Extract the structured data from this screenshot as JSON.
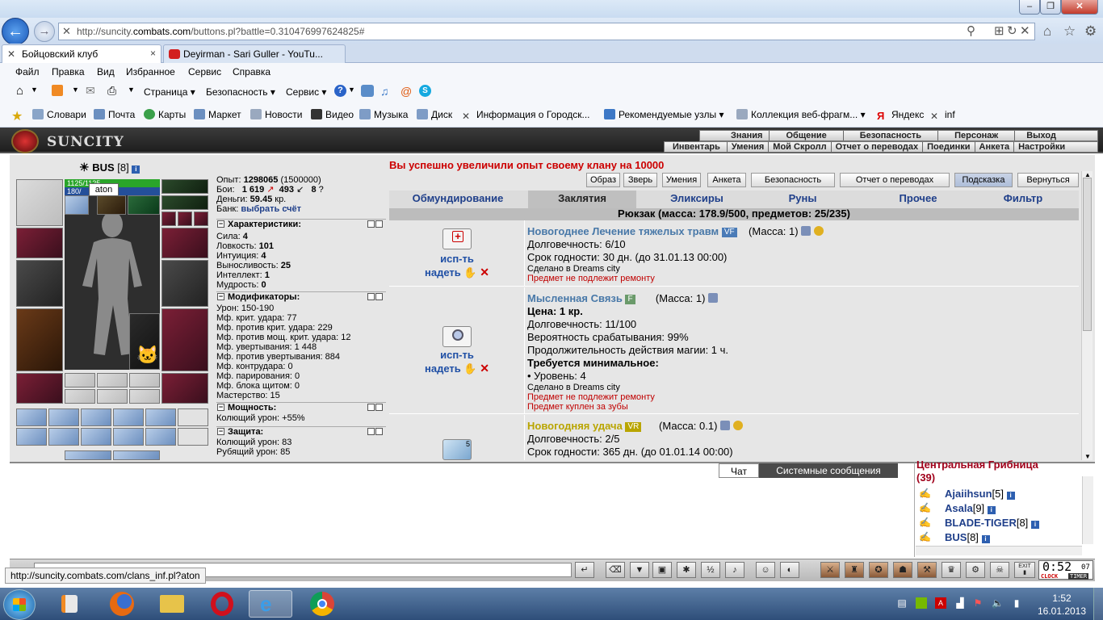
{
  "browser": {
    "url_prefix": "http://suncity.",
    "url_domain": "combats.com",
    "url_rest": "/buttons.pl?battle=0.310476997624825#",
    "tabs": [
      {
        "label": "Бойцовский клуб",
        "close": "×"
      },
      {
        "label": "Deyirman - Sari Guller - YouTu..."
      }
    ],
    "menu": [
      "Файл",
      "Правка",
      "Вид",
      "Избранное",
      "Сервис",
      "Справка"
    ],
    "command": [
      "Страница",
      "Безопасность",
      "Сервис"
    ],
    "favorites": [
      "Словари",
      "Почта",
      "Карты",
      "Маркет",
      "Новости",
      "Видео",
      "Музыка",
      "Диск",
      "Информация о Городск...",
      "Рекомендуемые узлы",
      "Коллекция веб-фрагм...",
      "Яндекс",
      "inf"
    ],
    "status_url": "http://suncity.combats.com/clans_inf.pl?aton"
  },
  "game": {
    "logo": "SUNCITY",
    "nav_top": [
      "Знания",
      "Общение",
      "Безопасность",
      "Персонаж",
      "Выход"
    ],
    "nav_bottom": [
      "Инвентарь",
      "Умения",
      "Мой Скролл",
      "Отчет о переводах",
      "Поединки",
      "Анкета",
      "Настройки"
    ]
  },
  "character": {
    "name": "BUS",
    "level": "[8]",
    "hp": "1125/1125",
    "mp": "180/",
    "tooltip": "aton",
    "exp_label": "Опыт:",
    "exp": "1298065",
    "exp_next": "(1500000)",
    "fights_label": "Бои:",
    "wins": "1 619",
    "losses": "493",
    "draws": "8",
    "money_label": "Деньги:",
    "money": "59.45",
    "money_unit": "кр.",
    "bank_label": "Банк:",
    "bank_link": "выбрать счёт"
  },
  "stats": {
    "characteristics_title": "Характеристики:",
    "characteristics": [
      {
        "label": "Сила:",
        "value": "4"
      },
      {
        "label": "Ловкость:",
        "value": "101"
      },
      {
        "label": "Интуиция:",
        "value": "4"
      },
      {
        "label": "Выносливость:",
        "value": "25"
      },
      {
        "label": "Интеллект:",
        "value": "1"
      },
      {
        "label": "Мудрость:",
        "value": "0"
      }
    ],
    "modifiers_title": "Модификаторы:",
    "modifiers": [
      "Урон: 150-190",
      "Мф. крит. удара: 77",
      "Мф. против крит. удара: 229",
      "Мф. против мощ. крит. удара: 12",
      "Мф. увертывания: 1 448",
      "Мф. против увертывания: 884",
      "Мф. контрудара: 0",
      "Мф. парирования: 0",
      "Мф. блока щитом: 0",
      "Мастерство: 15"
    ],
    "power_title": "Мощность:",
    "power": [
      "Колющий урон: +55%"
    ],
    "defense_title": "Защита:",
    "defense": [
      "Колющий урон: 83",
      "Рубящий урон: 85"
    ]
  },
  "inventory": {
    "message": "Вы успешно увеличили опыт своему клану на 10000",
    "buttons": [
      "Образ",
      "Зверь",
      "Умения",
      "Анкета",
      "Безопасность",
      "Отчет о переводах",
      "Подсказка",
      "Вернуться"
    ],
    "tabs": [
      "Обмундирование",
      "Заклятия",
      "Эликсиры",
      "Руны",
      "Прочее",
      "Фильтр"
    ],
    "backpack": "Рюкзак (масса: 178.9/500, предметов: 25/235)",
    "use_line1": "исп-ть",
    "use_line2": "надеть",
    "delete": "✕",
    "items": [
      {
        "title": "Новогоднее Лечение тяжелых травм",
        "tag": "VF",
        "mass": "(Масса: 1)",
        "lines": [
          "Долговечность: 6/10",
          "Срок годности: 30 дн. (до 31.01.13 00:00)"
        ],
        "made": "Сделано в Dreams city",
        "red": [
          "Предмет не подлежит ремонту"
        ]
      },
      {
        "title": "Мысленная Связь",
        "tag": "F",
        "mass": "(Масса: 1)",
        "price": "Цена: 1 кр.",
        "lines": [
          "Долговечность: 11/100",
          "Вероятность срабатывания: 99%",
          "Продолжительность действия магии: 1 ч."
        ],
        "req_title": "Требуется минимальное:",
        "req": "• Уровень: 4",
        "made": "Сделано в Dreams city",
        "red": [
          "Предмет не подлежит ремонту",
          "Предмет куплен за зубы"
        ]
      },
      {
        "title": "Новогодняя удача",
        "tag": "VR",
        "mass": "(Масса: 0.1)",
        "count": "5",
        "lines": [
          "Долговечность: 2/5",
          "Срок годности: 365 дн. (до 01.01.14 00:00)"
        ]
      }
    ]
  },
  "chat": {
    "tabs": [
      "Чат",
      "Системные сообщения"
    ],
    "room": "Центральная Грибница",
    "room_count": "(39)",
    "users": [
      {
        "name": "Ajaiihsun",
        "level": "[5]"
      },
      {
        "name": "Asala",
        "level": "[9]"
      },
      {
        "name": "BLADE-TIGER",
        "level": "[8]"
      },
      {
        "name": "BUS",
        "level": "[8]"
      }
    ],
    "clock": "0:52",
    "clock_sec": "07",
    "clock_label": "CLOCK",
    "timer_label": "TIMER",
    "exit_label": "EXIT"
  },
  "taskbar": {
    "time": "1:52",
    "date": "16.01.2013"
  },
  "colors": {
    "accent_red": "#cc0000",
    "link_blue": "#1f3f8a",
    "item_title": "#4878a8",
    "item_title_gold": "#b9a500"
  }
}
